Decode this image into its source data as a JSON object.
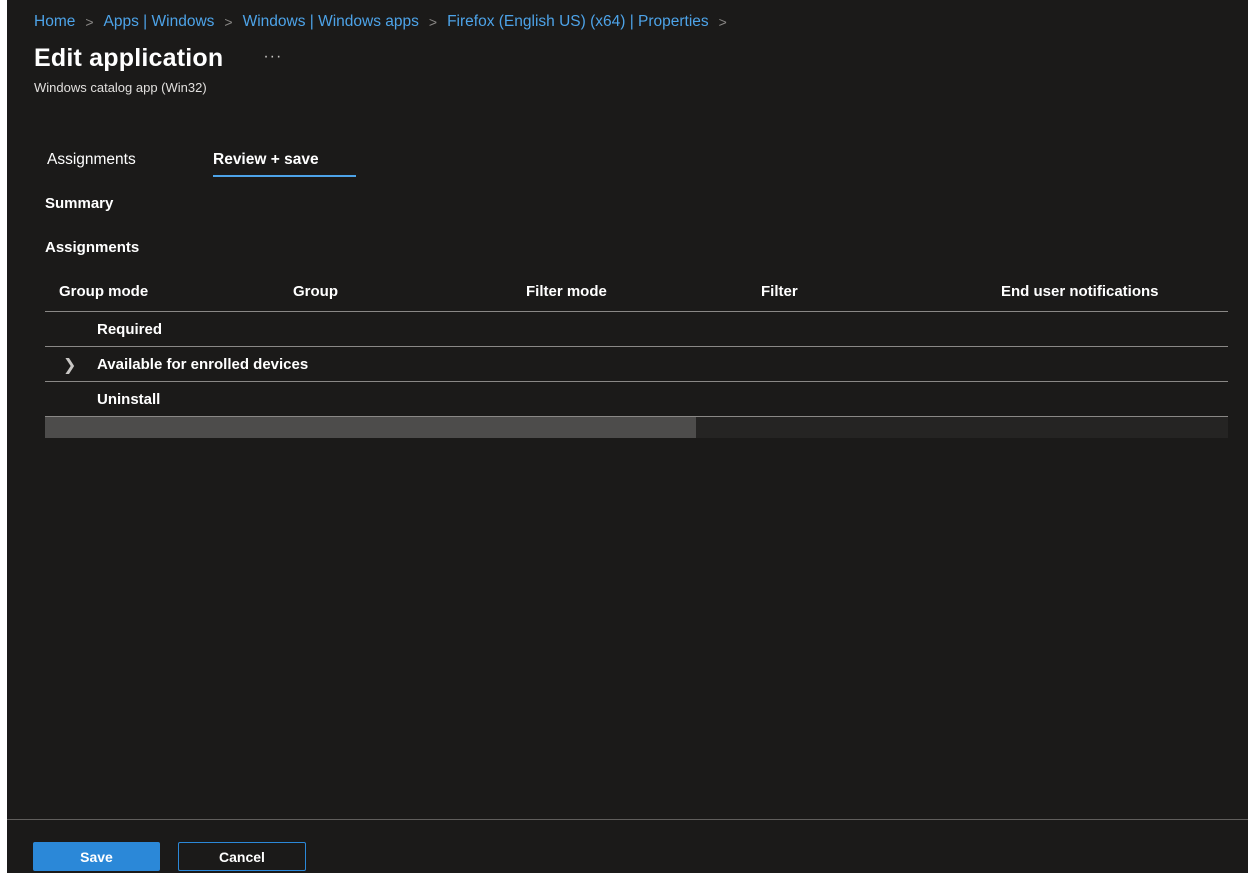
{
  "breadcrumb": {
    "items": [
      "Home",
      "Apps | Windows",
      "Windows | Windows apps",
      "Firefox (English US) (x64) | Properties"
    ],
    "separator": ">"
  },
  "header": {
    "title": "Edit application",
    "more_label": "···",
    "subtitle": "Windows catalog app (Win32)"
  },
  "tabs": [
    {
      "label": "Assignments",
      "active": false
    },
    {
      "label": "Review + save",
      "active": true
    }
  ],
  "summary": {
    "heading": "Summary",
    "assignments_heading": "Assignments",
    "table": {
      "columns": [
        "Group mode",
        "Group",
        "Filter mode",
        "Filter",
        "End user notifications"
      ],
      "rows": [
        {
          "label": "Required",
          "expandable": false
        },
        {
          "label": "Available for enrolled devices",
          "expandable": true
        },
        {
          "label": "Uninstall",
          "expandable": false
        }
      ]
    },
    "horizontal_scroll_position": 0.55
  },
  "footer": {
    "save_label": "Save",
    "cancel_label": "Cancel"
  },
  "icons": {
    "chevron": "chevron-right-icon",
    "more": "more-icon"
  },
  "colors": {
    "background": "#1b1a19",
    "accent": "#2b88d8",
    "link": "#4da3e8",
    "divider": "#8a8886"
  }
}
